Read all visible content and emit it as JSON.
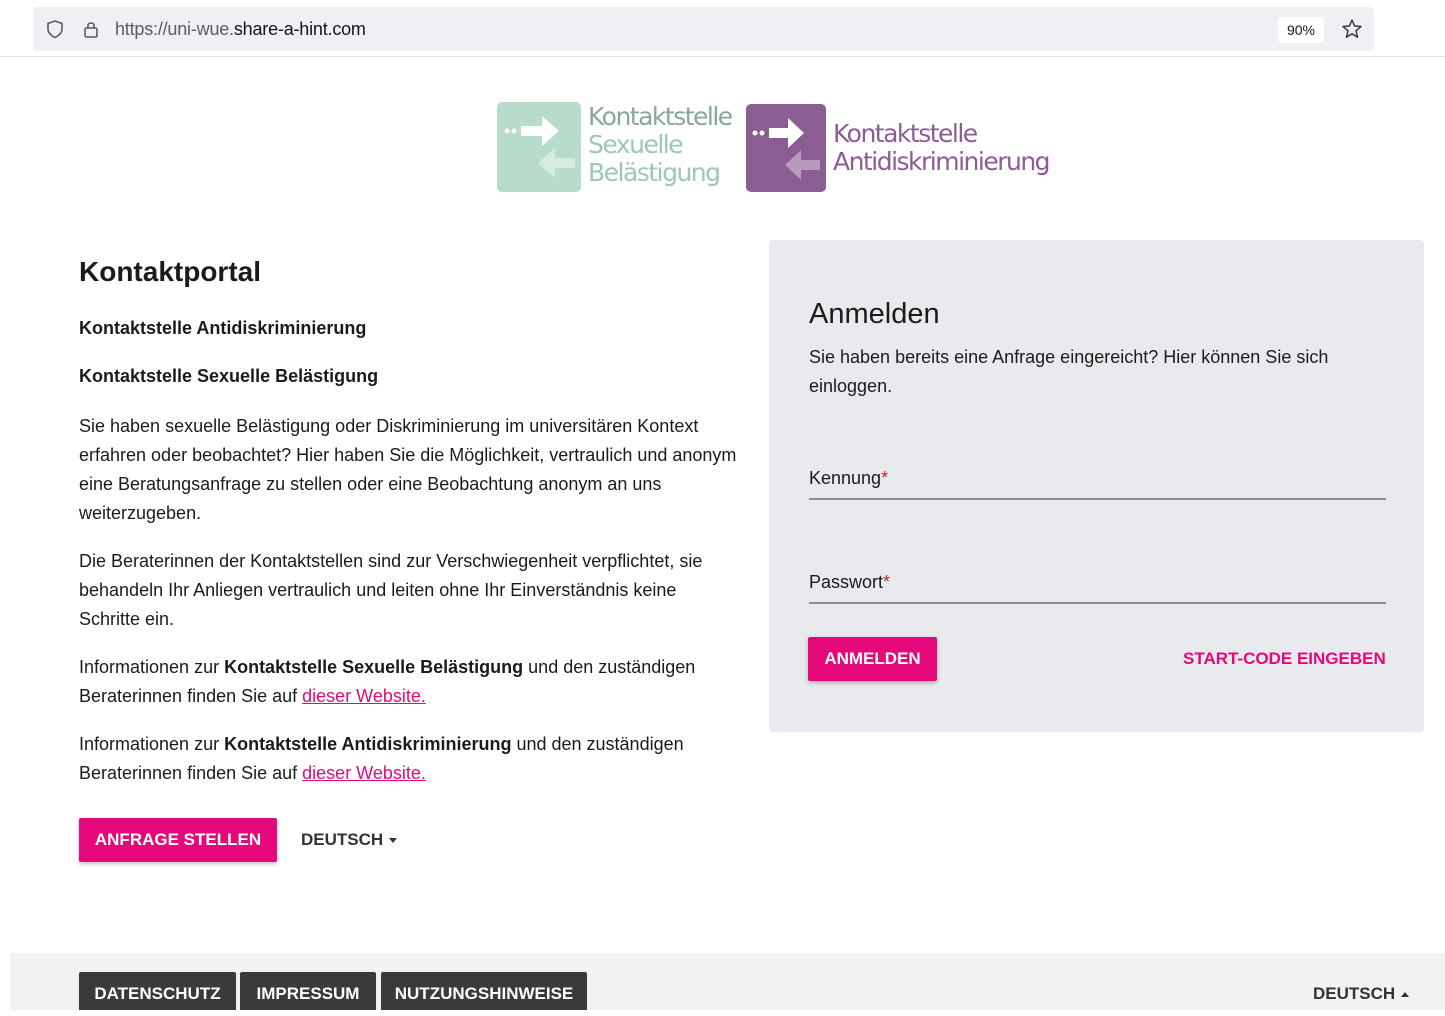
{
  "browser": {
    "url_prefix": "https://uni-wue.",
    "url_domain": "share-a-hint.com",
    "zoom": "90%"
  },
  "logos": {
    "logo1": {
      "line1": "Kontaktstelle",
      "line2": "Sexuelle",
      "line3": "Belästigung",
      "color": "#9bc9b2"
    },
    "logo2": {
      "line1": "Kontaktstelle",
      "line2": "Antidiskriminierung",
      "color": "#8a5d93"
    }
  },
  "main": {
    "title": "Kontaktportal",
    "sub1": "Kontaktstelle Antidiskriminierung",
    "sub2": "Kontaktstelle Sexuelle Belästigung",
    "para1": "Sie haben sexuelle Belästigung oder Diskriminierung im universitären Kontext erfahren oder beobachtet? Hier haben Sie die Möglichkeit, vertraulich und anonym eine Beratungsanfrage zu stellen oder eine Beobachtung anonym an uns weiterzugeben.",
    "para2": "Die Beraterinnen der Kontaktstellen sind zur Verschwiegenheit verpflichtet, sie behandeln Ihr Anliegen vertraulich und leiten ohne Ihr Einverständnis keine Schritte ein.",
    "info1": {
      "prefix": "Informationen zur ",
      "bold": "Kontaktstelle Sexuelle Belästigung",
      "middle": " und den zuständigen Beraterinnen finden Sie auf ",
      "link": "dieser Website."
    },
    "info2": {
      "prefix": "Informationen zur ",
      "bold": "Kontaktstelle Antidiskriminierung",
      "middle": " und den zuständigen Beraterinnen finden Sie auf ",
      "link": "dieser Website."
    },
    "request_button": "ANFRAGE STELLEN",
    "language": "DEUTSCH"
  },
  "login": {
    "title": "Anmelden",
    "text": "Sie haben bereits eine Anfrage eingereicht? Hier können Sie sich einloggen.",
    "username_label": "Kennung",
    "password_label": "Passwort",
    "required_mark": "*",
    "login_button": "ANMELDEN",
    "startcode_button": "START-CODE EINGEBEN"
  },
  "footer": {
    "privacy": "DATENSCHUTZ",
    "imprint": "IMPRESSUM",
    "terms": "NUTZUNGSHINWEISE",
    "language": "DEUTSCH"
  },
  "colors": {
    "accent": "#e5087a",
    "card_bg": "#e8eaed",
    "footer_btn": "#3a3a3a"
  }
}
